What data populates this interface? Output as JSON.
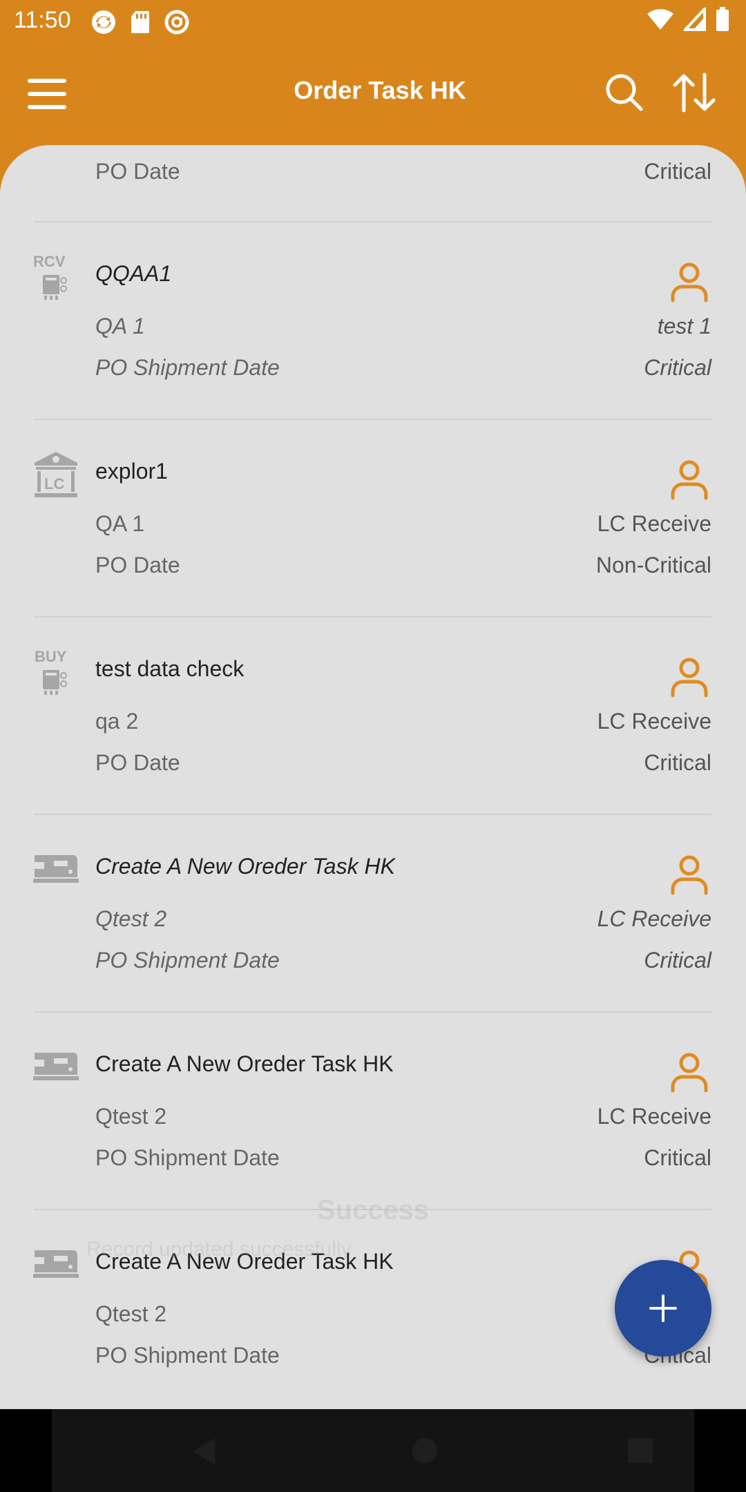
{
  "status_bar": {
    "time": "11:50",
    "icons": [
      "sync-icon",
      "sd-card-icon",
      "at-sign-icon",
      "wifi-icon",
      "signal-icon",
      "battery-icon"
    ]
  },
  "app_bar": {
    "title": "Order Task HK",
    "background": "#d8861c"
  },
  "partial_row": {
    "left": "PO Date",
    "right": "Critical"
  },
  "tasks": [
    {
      "title": "QQAA1",
      "type_icon": "rcv-icon",
      "type_label": "RCV",
      "assignee": "QA 1",
      "stage": "test 1",
      "date_type": "PO Shipment Date",
      "priority": "Critical",
      "italic": true
    },
    {
      "title": "explor1",
      "type_icon": "lc-bank-icon",
      "type_label": "LC",
      "assignee": "QA 1",
      "stage": "LC Receive",
      "date_type": "PO Date",
      "priority": "Non-Critical",
      "italic": false
    },
    {
      "title": "test data check",
      "type_icon": "buy-icon",
      "type_label": "BUY",
      "assignee": "qa 2",
      "stage": "LC Receive",
      "date_type": "PO Date",
      "priority": "Critical",
      "italic": false
    },
    {
      "title": "Create A New Oreder Task HK",
      "type_icon": "sewing-machine-icon",
      "assignee": "Qtest 2",
      "stage": "LC Receive",
      "date_type": "PO Shipment Date",
      "priority": "Critical",
      "italic": true
    },
    {
      "title": "Create A New Oreder Task HK",
      "type_icon": "sewing-machine-icon",
      "assignee": "Qtest 2",
      "stage": "LC Receive",
      "date_type": "PO Shipment Date",
      "priority": "Critical",
      "italic": false
    },
    {
      "title": "Create A New Oreder Task HK",
      "type_icon": "sewing-machine-icon",
      "assignee": "Qtest 2",
      "stage": "LC",
      "date_type": "PO Shipment Date",
      "priority": "Critical",
      "italic": false
    }
  ],
  "toast": {
    "title": "Success",
    "message": "Record updated successfully"
  },
  "colors": {
    "accent": "#d8861c",
    "person_icon": "#e08b22",
    "fab": "#254a9a",
    "sheet": "#e0e0e0"
  }
}
